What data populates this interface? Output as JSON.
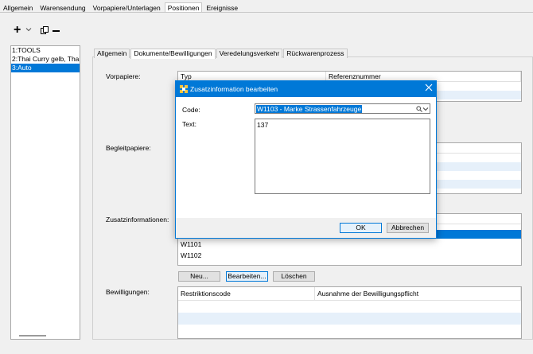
{
  "top_tabs": [
    "Allgemein",
    "Warensendung",
    "Vorpapiere/Unterlagen",
    "Positionen",
    "Ereignisse"
  ],
  "active_top_tab": "Positionen",
  "toolbar": {
    "add_icon": "plus-icon",
    "dropdown_icon": "chevron-down-icon",
    "copy_icon": "copy-icon",
    "remove_icon": "minus-icon"
  },
  "positions": [
    "1:TOOLS",
    "2:Thai Curry gelb, Thai C",
    "3:Auto"
  ],
  "selected_position": "3:Auto",
  "inner_tabs": [
    "Allgemein",
    "Dokumente/Bewilligungen",
    "Veredelungsverkehr",
    "Rückwarenprozess"
  ],
  "active_inner_tab": "Dokumente/Bewilligungen",
  "sections": {
    "vorpapiere": {
      "label": "Vorpapiere:",
      "col1": "Typ",
      "col2": "Referenznummer"
    },
    "begleitpapiere": {
      "label": "Begleitpapiere:"
    },
    "zusatzinformationen": {
      "label": "Zusatzinformationen:",
      "rows": [
        "W1101",
        "W1102"
      ]
    },
    "bewilligungen": {
      "label": "Bewilligungen:",
      "col1": "Restriktionscode",
      "col2": "Ausnahme der Bewilligungspflicht"
    }
  },
  "buttons": {
    "neu": "Neu...",
    "bearbeiten": "Bearbeiten...",
    "loeschen": "Löschen"
  },
  "dialog": {
    "title": "Zusatzinformation bearbeiten",
    "close_icon": "close-icon",
    "code_label": "Code:",
    "code_value": "W1103 - Marke Strassenfahrzeuge",
    "text_label": "Text:",
    "text_value": "137",
    "ok": "OK",
    "cancel": "Abbrechen"
  },
  "colors": {
    "accent": "#0078d7",
    "alt_row": "#e6f0fa"
  }
}
